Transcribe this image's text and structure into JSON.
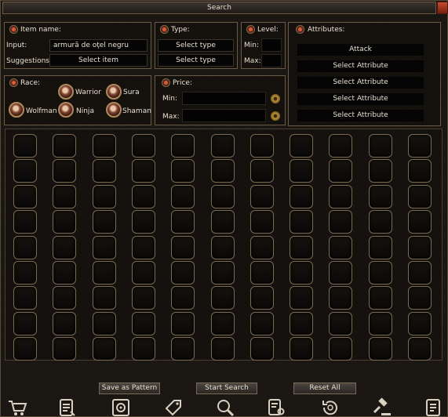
{
  "title": "Search",
  "item_section": {
    "header": "Item name:",
    "input_label": "Input:",
    "input_value": "armură de oțel negru",
    "suggestions_label": "Suggestions:",
    "suggestions_value": "Select item"
  },
  "type_section": {
    "header": "Type:",
    "type1": "Select type",
    "type2": "Select type"
  },
  "level_section": {
    "header": "Level:",
    "min_label": "Min:",
    "max_label": "Max:"
  },
  "attributes_section": {
    "header": "Attributes:",
    "rows": [
      "Attack",
      "Select Attribute",
      "Select Attribute",
      "Select Attribute",
      "Select Attribute"
    ]
  },
  "race_section": {
    "header": "Race:",
    "races": [
      "Warrior",
      "Sura",
      "Wolfman",
      "Ninja",
      "Shaman"
    ]
  },
  "price_section": {
    "header": "Price:",
    "min_label": "Min:",
    "max_label": "Max:"
  },
  "buttons": {
    "save_pattern": "Save as Pattern",
    "start_search": "Start Search",
    "reset_all": "Reset All"
  },
  "toolbar_icons": [
    "cart-icon",
    "document-list-icon",
    "safe-icon",
    "price-tag-icon",
    "magnifier-icon",
    "search-document-icon",
    "history-coin-icon",
    "auction-gavel-icon",
    "ledger-icon"
  ]
}
